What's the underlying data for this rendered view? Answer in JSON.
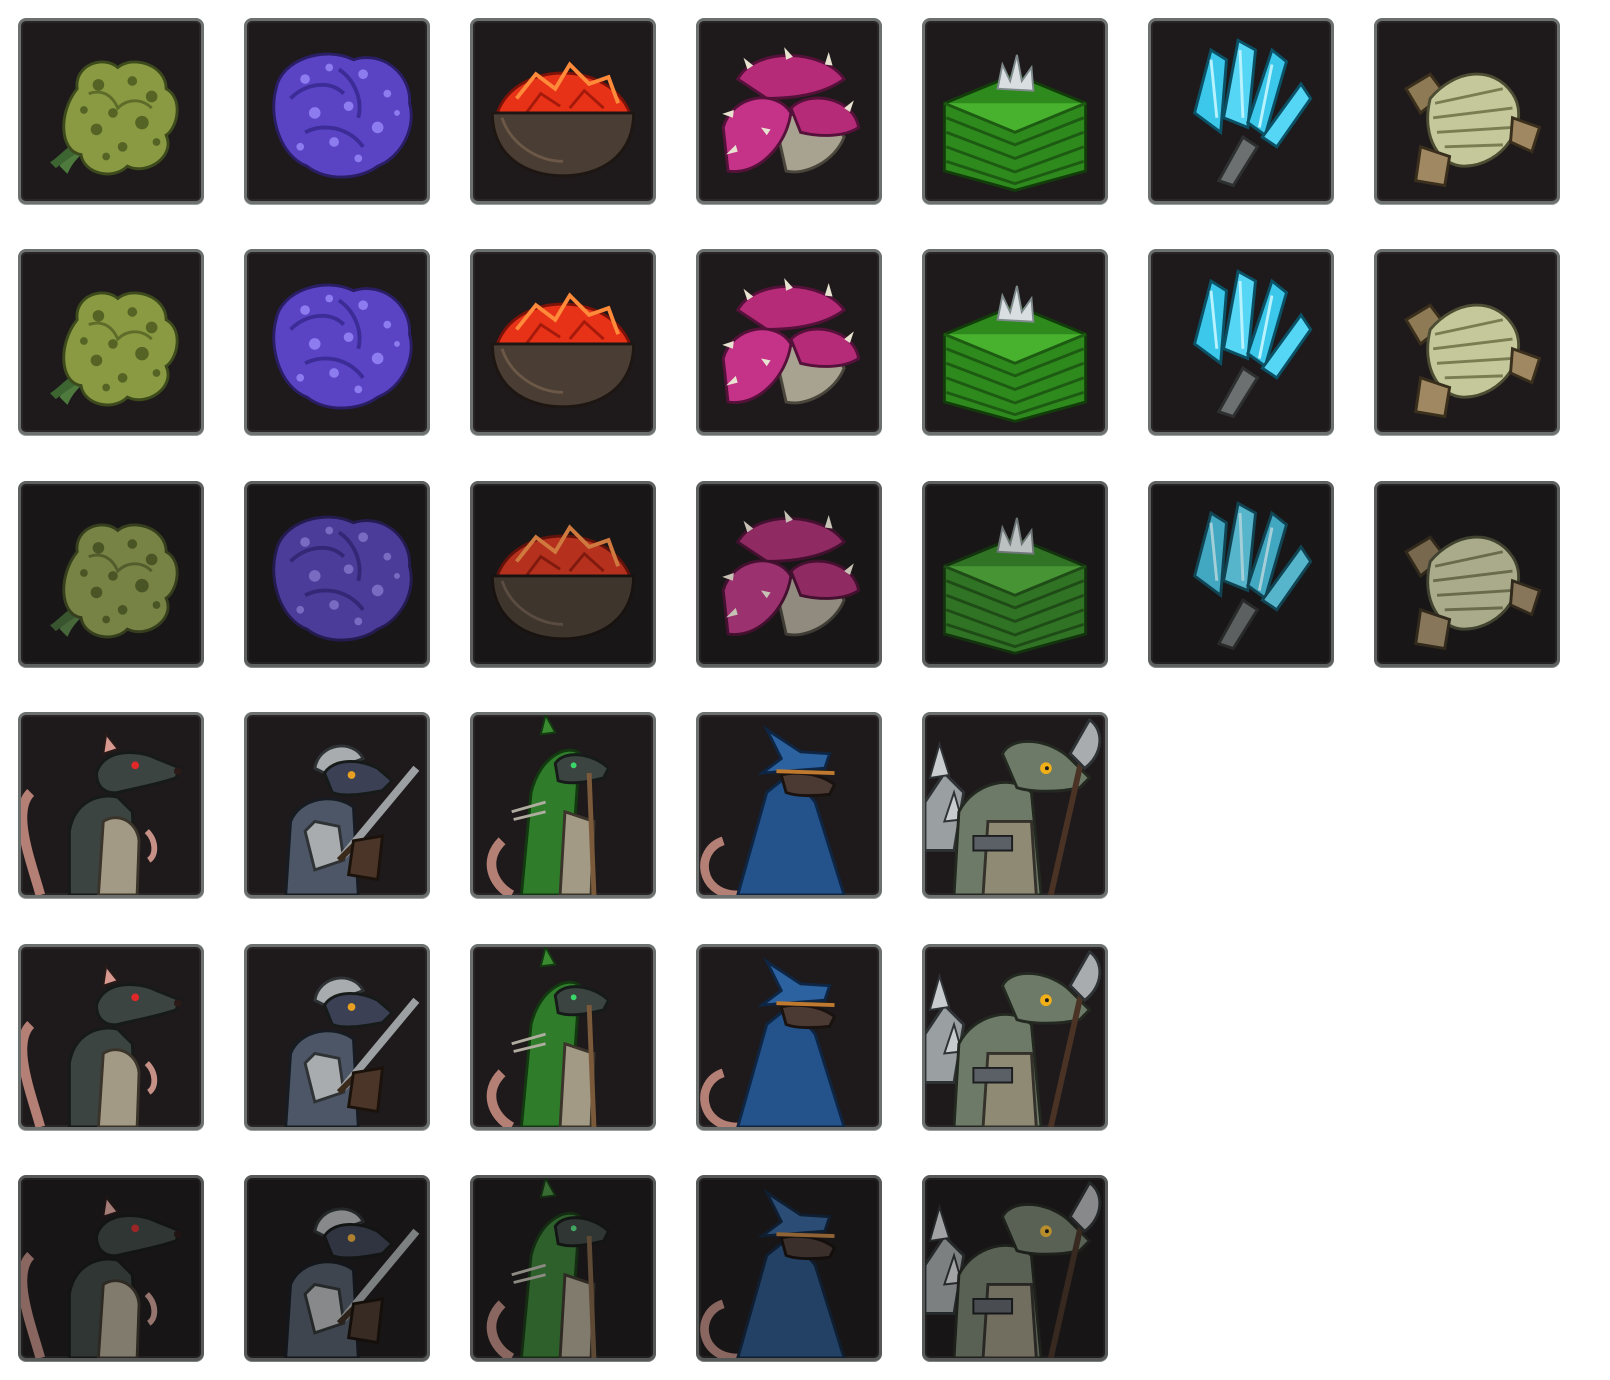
{
  "colors": {
    "tile_background": "#1e1a1b",
    "tile_border": "#6c706f",
    "page_background": "#ffffff"
  },
  "resource_icons": [
    "lichen-icon",
    "blueberry-cluster-icon",
    "ember-bowl-icon",
    "spiked-mushroom-icon",
    "moss-stack-icon",
    "ice-crystal-sprig-icon",
    "bandage-roll-icon"
  ],
  "rat_icons": [
    "rat-scout-icon",
    "rat-knight-icon",
    "rat-ranger-icon",
    "rat-wizard-icon",
    "rat-brute-icon"
  ],
  "icon_states": [
    "normal",
    "hover",
    "disabled"
  ]
}
